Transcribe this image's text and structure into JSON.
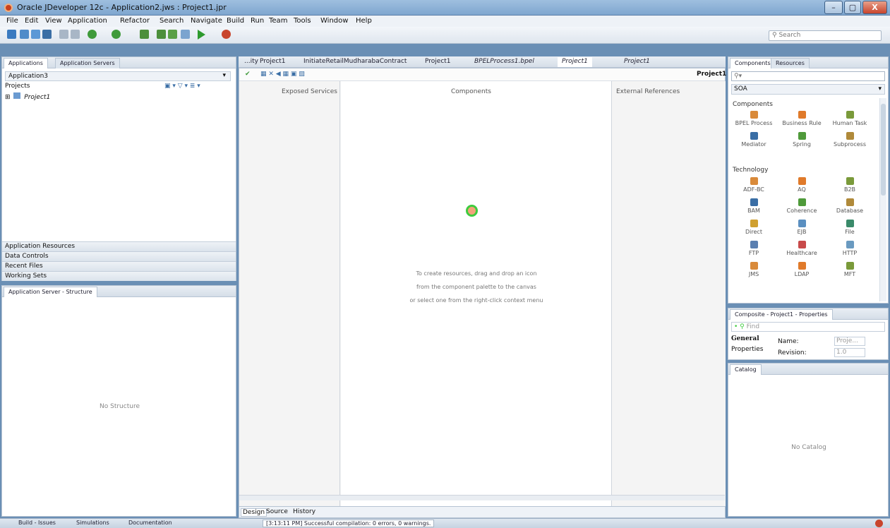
{
  "window": {
    "title": "Oracle JDeveloper 12c - Application2.jws : Project1.jpr",
    "controls": [
      "–",
      "▢",
      "X"
    ]
  },
  "menu": [
    "File",
    "Edit",
    "View",
    "Application",
    "Refactor",
    "Search",
    "Navigate",
    "Build",
    "Run",
    "Team",
    "Tools",
    "Window",
    "Help"
  ],
  "toolbar": {
    "search_placeholder": "Search"
  },
  "left_panel": {
    "tabs": [
      "Applications",
      "Application Servers"
    ],
    "app_selector": "Application3",
    "projects_label": "Projects",
    "project_item": "Project1",
    "sections": [
      "Application Resources",
      "Data Controls",
      "Recent Files",
      "Working Sets"
    ]
  },
  "structure_panel": {
    "title": "Application Server - Structure",
    "empty_text": "No Structure"
  },
  "editor": {
    "tabs": [
      "...ity",
      "Project1",
      "InitiateRetailMudharabaContract",
      "Project1",
      "BPELProcess1.bpel",
      "Project1",
      "Project1"
    ],
    "active_tab": "Project1",
    "project_label": "Project1",
    "columns": [
      "Exposed Services",
      "Components",
      "External References"
    ],
    "hint_lines": [
      "To create resources, drag and drop an icon",
      "from the component palette to the canvas",
      "or select one from the right-click context menu"
    ],
    "bottom_tabs": [
      "Design",
      "Source",
      "History"
    ]
  },
  "palette": {
    "tabs": [
      "Components",
      "Resources"
    ],
    "category": "SOA",
    "groups": {
      "components_label": "Components",
      "components": [
        {
          "label": "BPEL Process",
          "icon": "bpel-icon"
        },
        {
          "label": "Business Rule",
          "icon": "rule-icon"
        },
        {
          "label": "Human Task",
          "icon": "human-task-icon"
        },
        {
          "label": "Mediator",
          "icon": "mediator-icon"
        },
        {
          "label": "Spring",
          "icon": "spring-icon"
        },
        {
          "label": "Subprocess",
          "icon": "subprocess-icon"
        }
      ],
      "technology_label": "Technology",
      "technology": [
        {
          "label": "ADF-BC",
          "icon": "adf-icon"
        },
        {
          "label": "AQ",
          "icon": "aq-icon"
        },
        {
          "label": "B2B",
          "icon": "b2b-icon"
        },
        {
          "label": "BAM",
          "icon": "bam-icon"
        },
        {
          "label": "Coherence",
          "icon": "coherence-icon"
        },
        {
          "label": "Database",
          "icon": "database-icon"
        },
        {
          "label": "Direct",
          "icon": "direct-icon"
        },
        {
          "label": "EJB",
          "icon": "ejb-icon"
        },
        {
          "label": "File",
          "icon": "file-icon"
        },
        {
          "label": "FTP",
          "icon": "ftp-icon"
        },
        {
          "label": "Healthcare",
          "icon": "healthcare-icon"
        },
        {
          "label": "HTTP",
          "icon": "http-icon"
        },
        {
          "label": "JMS",
          "icon": "jms-icon"
        },
        {
          "label": "LDAP",
          "icon": "ldap-icon"
        },
        {
          "label": "MFT",
          "icon": "mft-icon"
        }
      ]
    }
  },
  "properties": {
    "title": "Composite - Project1 - Properties",
    "find_placeholder": "Find",
    "general": "General",
    "properties_tab": "Properties",
    "name_label": "Name:",
    "name_value": "Proje...",
    "revision_label": "Revision:",
    "revision_value": "1.0"
  },
  "catalog": {
    "title": "Catalog",
    "empty_text": "No Catalog"
  },
  "statusbar": {
    "tabs": [
      "Build - Issues",
      "Simulations",
      "Documentation"
    ],
    "message": "[3:13:11 PM] Successful compilation: 0 errors, 0 warnings."
  },
  "colors": {
    "accent": "#3a6ea5",
    "badge": "#c8452d"
  }
}
